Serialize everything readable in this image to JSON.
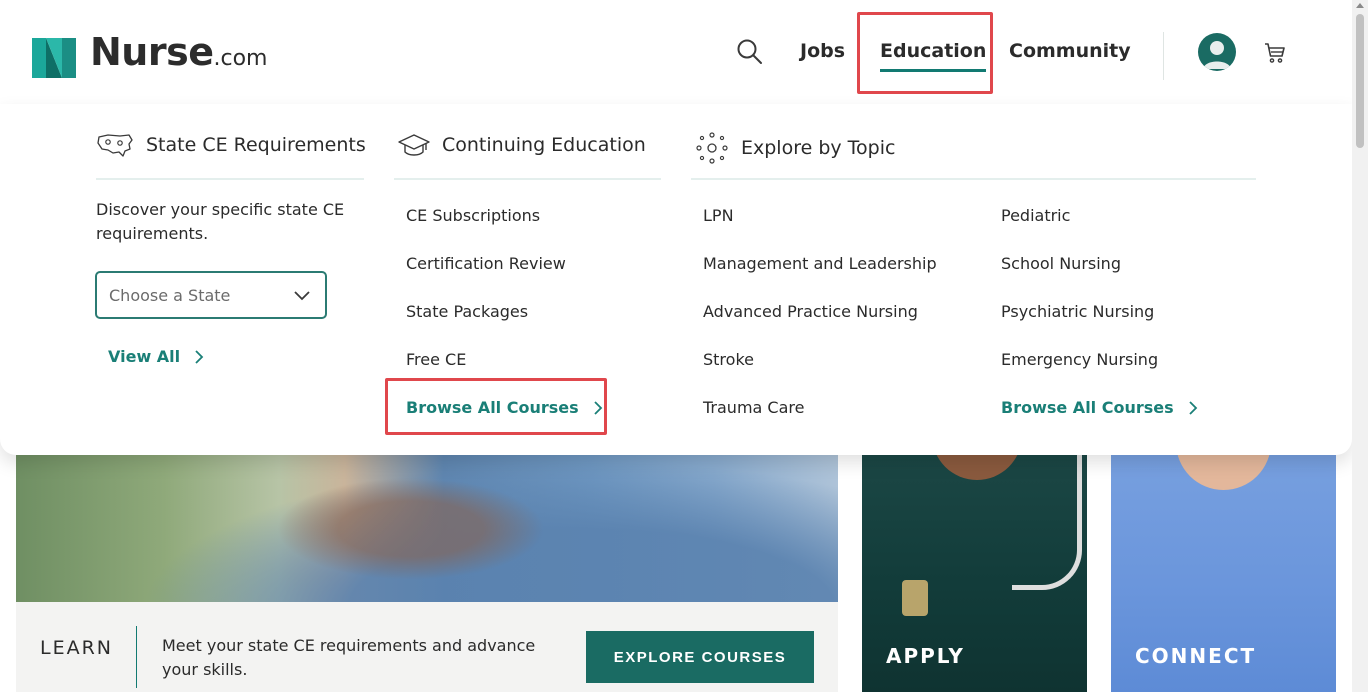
{
  "header": {
    "logo": {
      "name": "Nurse",
      "suffix": ".com"
    },
    "nav": {
      "jobs": "Jobs",
      "education": "Education",
      "community": "Community"
    },
    "icons": {
      "search": "search-icon",
      "avatar": "user-avatar-icon",
      "cart": "cart-icon"
    }
  },
  "mega_menu": {
    "state_ce": {
      "title": "State CE Requirements",
      "description": "Discover your specific state CE requirements.",
      "select_placeholder": "Choose a State",
      "view_all": "View All"
    },
    "continuing_education": {
      "title": "Continuing Education",
      "links": [
        "CE Subscriptions",
        "Certification Review",
        "State Packages",
        "Free CE"
      ],
      "browse_all": "Browse All Courses"
    },
    "explore_by_topic": {
      "title": "Explore by Topic",
      "links_col1": [
        "LPN",
        "Management and Leadership",
        "Advanced Practice Nursing",
        "Stroke",
        "Trauma Care"
      ],
      "links_col2": [
        "Pediatric",
        "School Nursing",
        "Psychiatric Nursing",
        "Emergency Nursing"
      ],
      "browse_all": "Browse All Courses"
    }
  },
  "hero": {
    "learn": {
      "title": "LEARN",
      "text": "Meet your state CE requirements and advance your skills.",
      "button": "EXPLORE COURSES"
    },
    "apply": {
      "title": "APPLY"
    },
    "connect": {
      "title": "CONNECT"
    }
  },
  "colors": {
    "brand_teal": "#1a6b63",
    "link_teal": "#1a7f77",
    "highlight_red": "#e0474c"
  }
}
